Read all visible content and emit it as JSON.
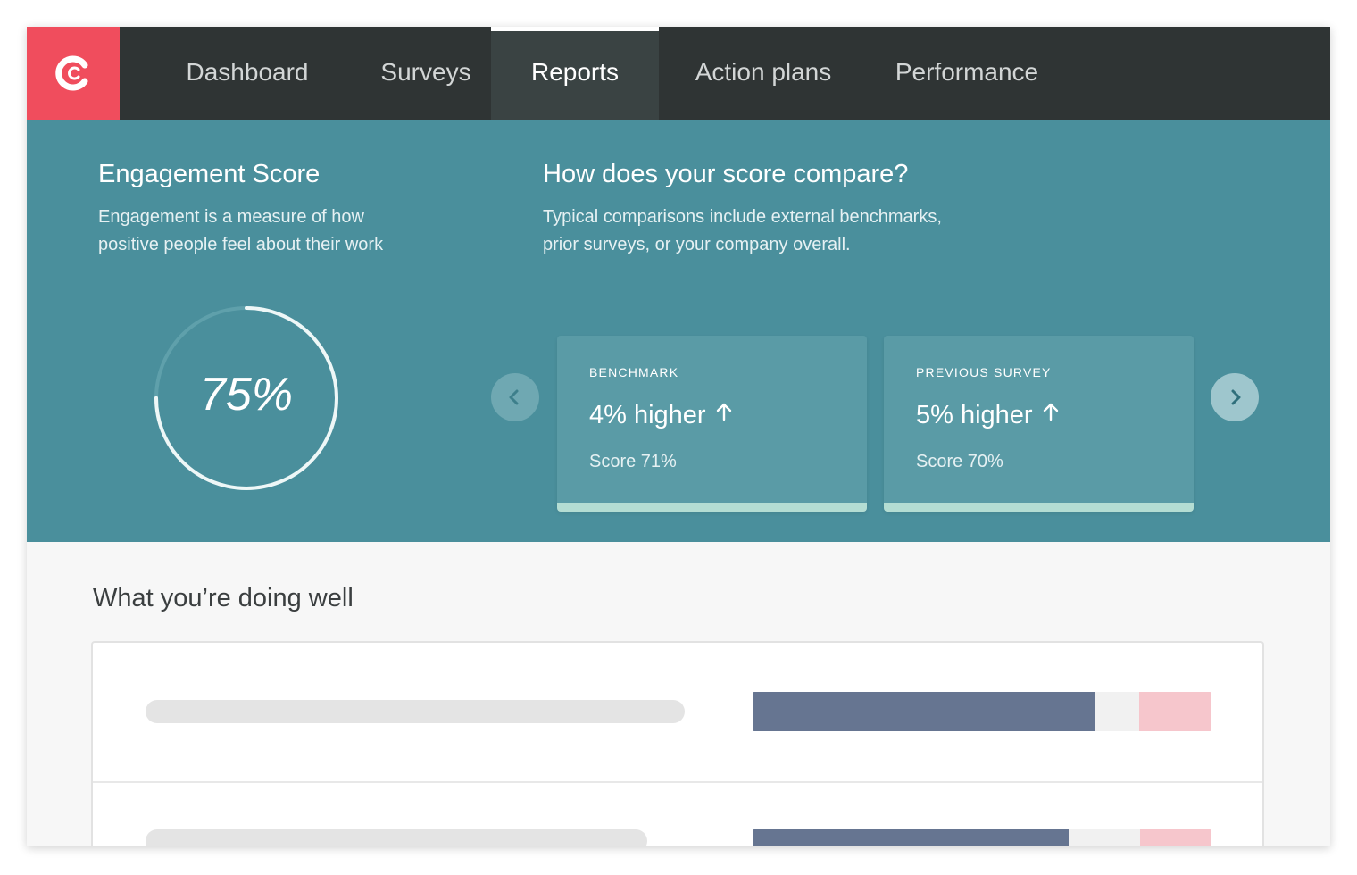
{
  "nav": {
    "logo": "logo-icon",
    "tabs": [
      {
        "label": "Dashboard",
        "active": false
      },
      {
        "label": "Surveys",
        "active": false
      },
      {
        "label": "Reports",
        "active": true
      },
      {
        "label": "Action plans",
        "active": false
      },
      {
        "label": "Performance",
        "active": false
      }
    ]
  },
  "engagement": {
    "title": "Engagement Score",
    "description_line1": "Engagement is a measure of how",
    "description_line2": "positive people feel about their work",
    "score_label": "75%",
    "score_fraction": 0.75
  },
  "compare": {
    "title": "How does your score compare?",
    "description_line1": "Typical comparisons include external benchmarks,",
    "description_line2": "prior surveys, or your company overall.",
    "cards": [
      {
        "label": "BENCHMARK",
        "value": "4% higher",
        "trend": "up-arrow-icon",
        "score": "Score 71%"
      },
      {
        "label": "PREVIOUS SURVEY",
        "value": "5% higher",
        "trend": "up-arrow-icon",
        "score": "Score 70%"
      }
    ],
    "prev_icon": "chevron-left-icon",
    "next_icon": "chevron-right-icon"
  },
  "doing_well": {
    "title": "What you’re doing well",
    "rows": [
      {
        "positive": 0.745,
        "neutral": 0.097,
        "negative": 0.158
      },
      {
        "positive": 0.688,
        "neutral": 0.156,
        "negative": 0.156
      }
    ]
  },
  "colors": {
    "nav_bg": "#2f3434",
    "brand": "#f04d5d",
    "hero_bg": "#4a8f9c",
    "card_bg": "#5a9ba6",
    "card_accent": "#b4ddd3",
    "positive": "#667591",
    "neutral": "#f1f1f1",
    "negative": "#f6c6cc"
  }
}
